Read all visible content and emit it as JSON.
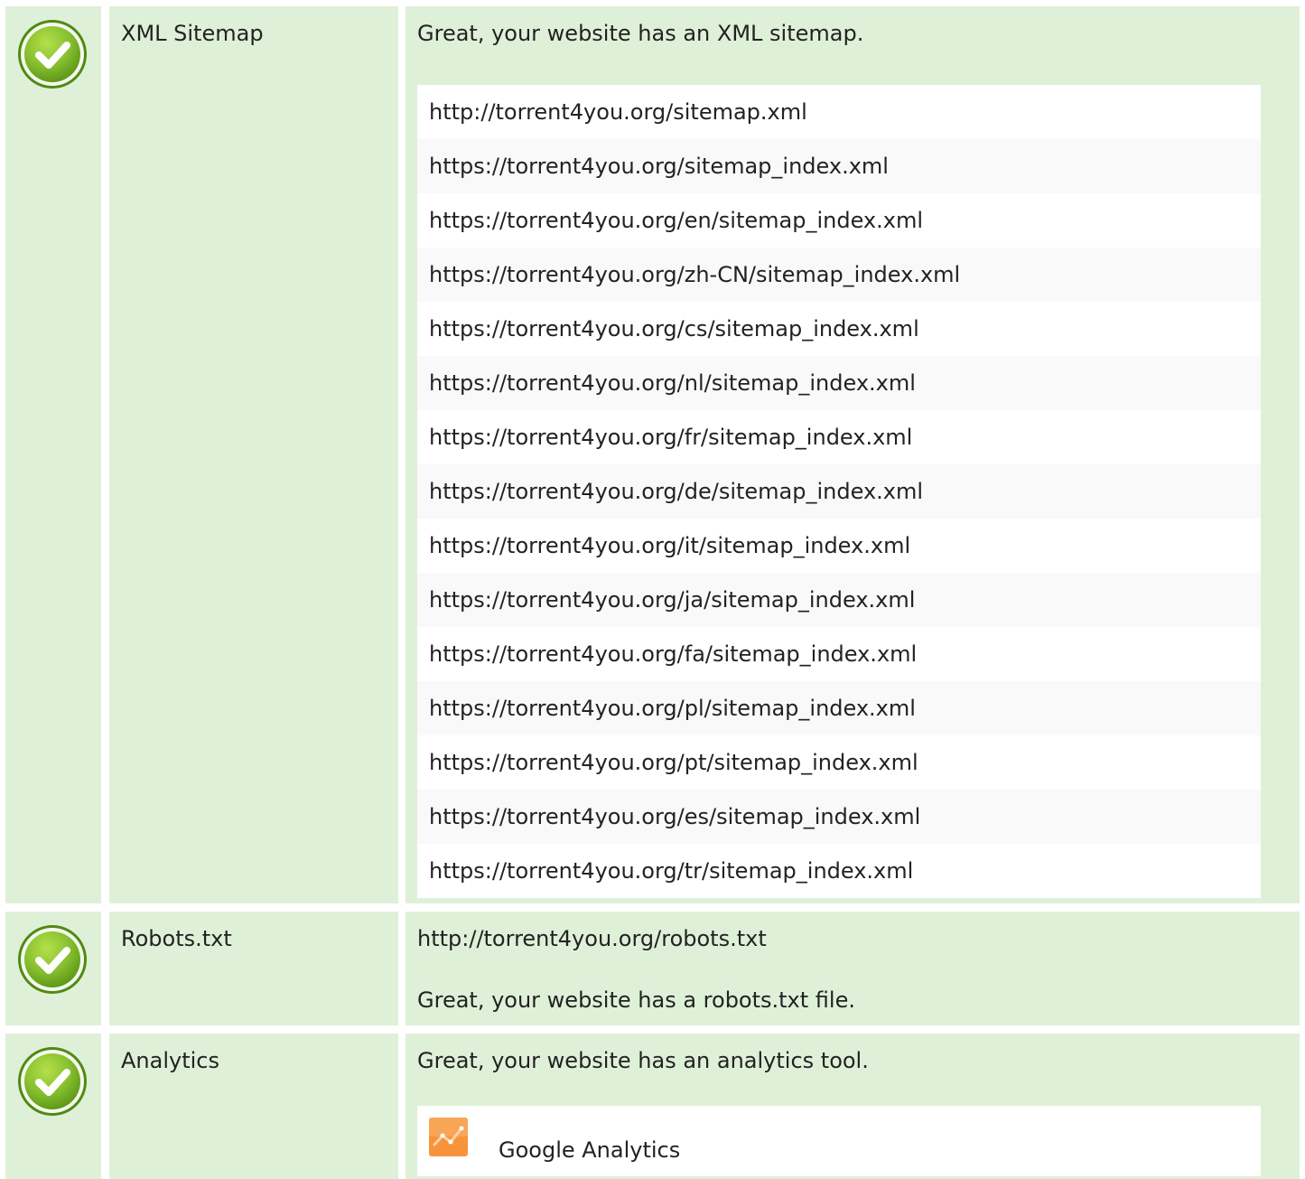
{
  "sitemap": {
    "label": "XML Sitemap",
    "message": "Great, your website has an XML sitemap.",
    "urls": [
      "http://torrent4you.org/sitemap.xml",
      "https://torrent4you.org/sitemap_index.xml",
      "https://torrent4you.org/en/sitemap_index.xml",
      "https://torrent4you.org/zh-CN/sitemap_index.xml",
      "https://torrent4you.org/cs/sitemap_index.xml",
      "https://torrent4you.org/nl/sitemap_index.xml",
      "https://torrent4you.org/fr/sitemap_index.xml",
      "https://torrent4you.org/de/sitemap_index.xml",
      "https://torrent4you.org/it/sitemap_index.xml",
      "https://torrent4you.org/ja/sitemap_index.xml",
      "https://torrent4you.org/fa/sitemap_index.xml",
      "https://torrent4you.org/pl/sitemap_index.xml",
      "https://torrent4you.org/pt/sitemap_index.xml",
      "https://torrent4you.org/es/sitemap_index.xml",
      "https://torrent4you.org/tr/sitemap_index.xml"
    ]
  },
  "robots": {
    "label": "Robots.txt",
    "url": "http://torrent4you.org/robots.txt",
    "message": "Great, your website has a robots.txt file."
  },
  "analytics": {
    "label": "Analytics",
    "message": "Great, your website has an analytics tool.",
    "tools": [
      {
        "name": "Google Analytics",
        "icon": "google-analytics-icon"
      }
    ]
  },
  "status_icon": "check-circle-icon",
  "colors": {
    "row_background": "#dff0d8",
    "check_green": "#7cb82f",
    "analytics_orange": "#f7943b"
  }
}
